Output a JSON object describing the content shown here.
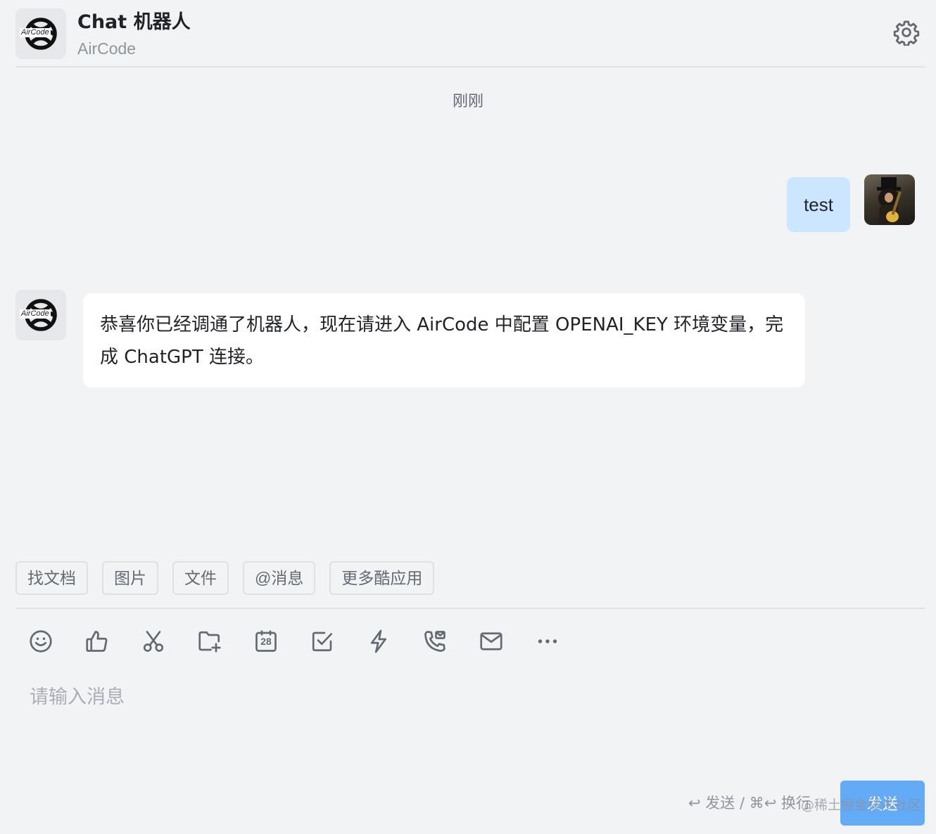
{
  "header": {
    "logo_text": "AirCode",
    "title": "Chat 机器人",
    "subtitle": "AirCode"
  },
  "chat": {
    "timestamp": "刚刚",
    "messages": [
      {
        "role": "user",
        "text": "test"
      },
      {
        "role": "bot",
        "text": "恭喜你已经调通了机器人，现在请进入 AirCode 中配置 OPENAI_KEY 环境变量，完成 ChatGPT 连接。"
      }
    ]
  },
  "quick_actions": [
    "找文档",
    "图片",
    "文件",
    "@消息",
    "更多酷应用"
  ],
  "toolbar": {
    "icons": [
      "emoji-icon",
      "thumbs-up-icon",
      "scissors-icon",
      "folder-add-icon",
      "calendar-icon",
      "checkbox-icon",
      "lightning-icon",
      "phone-call-icon",
      "mail-icon",
      "more-icon"
    ],
    "calendar_day": "28"
  },
  "input": {
    "placeholder": "请输入消息",
    "value": ""
  },
  "footer": {
    "hint": "↩ 发送 / ⌘↩ 换行",
    "send_label": "发送",
    "watermark": "@稀土掘金技术社区"
  },
  "colors": {
    "background": "#f2f3f5",
    "user_bubble": "#cde6ff",
    "bot_bubble": "#ffffff",
    "send_button": "#63aaf7",
    "icon": "#646a73"
  }
}
